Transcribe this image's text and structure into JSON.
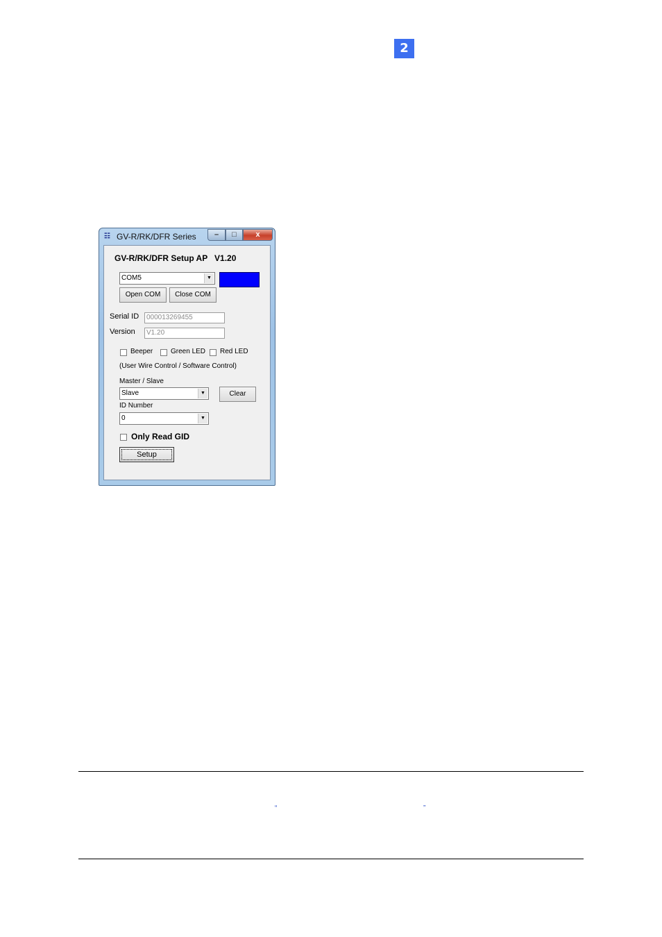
{
  "page": {
    "chapter_number": "2",
    "note_open_quote": "“",
    "note_close_quote": "”"
  },
  "window": {
    "title": "GV-R/RK/DFR Series",
    "app_icon": "app-icon",
    "controls": {
      "minimize": "–",
      "maximize": "□",
      "close": "x"
    },
    "heading": "GV-R/RK/DFR Setup AP   V1.20",
    "com_port": {
      "selected": "COM5"
    },
    "status_color": "#0000ff",
    "buttons": {
      "open_com": "Open COM",
      "close_com": "Close COM",
      "clear": "Clear",
      "setup": "Setup"
    },
    "serial_id": {
      "label": "Serial ID",
      "value": "000013269455"
    },
    "version": {
      "label": "Version",
      "value": "V1.20"
    },
    "checkboxes": [
      {
        "label": "Beeper",
        "checked": false
      },
      {
        "label": "Green LED",
        "checked": false
      },
      {
        "label": "Red LED",
        "checked": false
      }
    ],
    "control_note": "(User Wire Control / Software Control)",
    "master_slave": {
      "label": "Master / Slave",
      "selected": "Slave"
    },
    "id_number": {
      "label": "ID Number",
      "selected": "0"
    },
    "only_read_gid": {
      "label": "Only Read  GID",
      "checked": false
    }
  }
}
